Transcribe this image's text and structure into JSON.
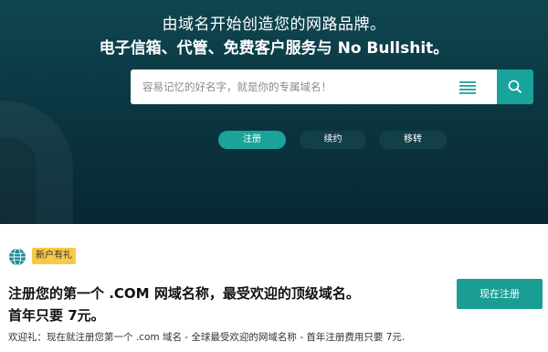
{
  "hero": {
    "headline_line1": "由域名开始创造您的网路品牌。",
    "headline_line2": "电子信箱、代管、免费客户服务与 No Bullshit。"
  },
  "search": {
    "placeholder": "容易记忆的好名字，就是你的专属域名！",
    "list_icon": "list-icon",
    "button_icon": "search-icon"
  },
  "tabs": [
    {
      "label": "注册",
      "active": true
    },
    {
      "label": "续约",
      "active": false
    },
    {
      "label": "移转",
      "active": false
    }
  ],
  "promo": {
    "icon": "globe-icon",
    "badge": "新户有礼",
    "title_line1": "注册您的第一个 .COM 网域名称，最受欢迎的顶级域名。",
    "title_line2": "首年只要 7元。",
    "description": "欢迎礼：现在就注册您第一个 .com 域名 - 全球最受欢迎的网域名称 - 首年注册费用只要 7元.",
    "register_label": "现在注册"
  },
  "colors": {
    "hero_dark": "#0a3440",
    "accent": "#1aa39a",
    "pill_inactive": "#123f48",
    "badge": "#f7c948"
  }
}
